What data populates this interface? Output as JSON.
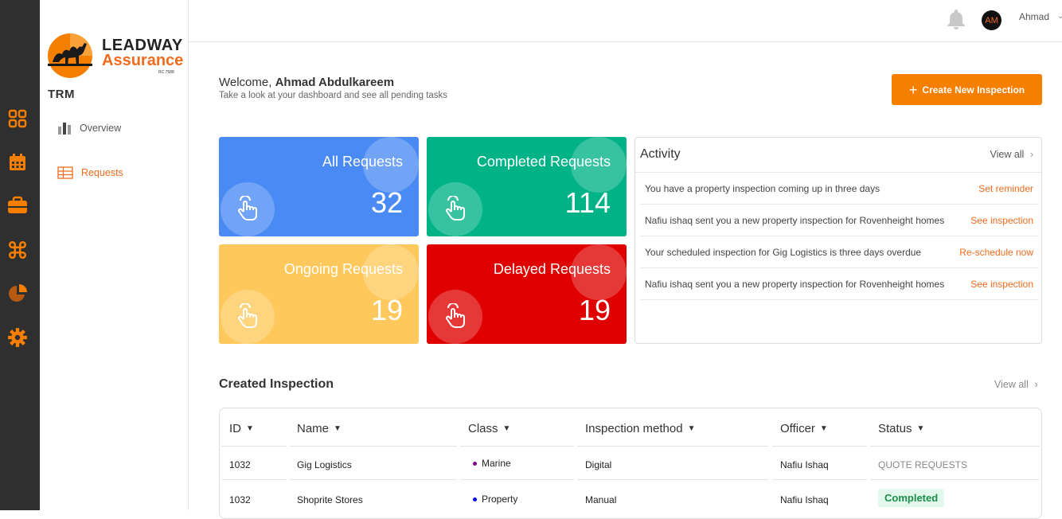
{
  "brand": {
    "line1": "LEADWAY",
    "line2": "Assurance",
    "rc": "RC 7588",
    "app": "TRM"
  },
  "nav": {
    "overview": "Overview",
    "requests": "Requests"
  },
  "user": {
    "initials": "AM",
    "name": "Ahmad"
  },
  "welcome": {
    "greeting": "Welcome,",
    "name": "Ahmad Abdulkareem",
    "subtitle": "Take a look at your dashboard and see all pending tasks"
  },
  "create_button": "Create New Inspection",
  "cards": [
    {
      "title": "All Requests",
      "count": "32",
      "color": "#4a8af4"
    },
    {
      "title": "Completed Requests",
      "count": "114",
      "color": "#00b386"
    },
    {
      "title": "Ongoing Requests",
      "count": "19",
      "color": "#ffc85c"
    },
    {
      "title": "Delayed Requests",
      "count": "19",
      "color": "#e00000"
    }
  ],
  "activity": {
    "title": "Activity",
    "view_all": "View all",
    "rows": [
      {
        "text": "You have a property inspection coming up in three days",
        "action": "Set reminder"
      },
      {
        "text": "Nafiu ishaq sent you a new property inspection for Rovenheight homes",
        "action": "See inspection"
      },
      {
        "text": "Your scheduled inspection for Gig Logistics is three days overdue",
        "action": "Re-schedule now"
      },
      {
        "text": "Nafiu ishaq sent you a new property inspection for Rovenheight homes",
        "action": "See inspection"
      }
    ]
  },
  "inspections": {
    "title": "Created Inspection",
    "view_all": "View all",
    "columns": [
      "ID",
      "Name",
      "Class",
      "Inspection method",
      "Officer",
      "Status"
    ],
    "rows": [
      {
        "id": "1032",
        "name": "Gig Logistics",
        "class": "Marine",
        "class_color": "#800080",
        "method": "Digital",
        "officer": "Nafiu Ishaq",
        "status": "QUOTE REQUESTS"
      },
      {
        "id": "1032",
        "name": "Shoprite Stores",
        "class": "Property",
        "class_color": "#0000ff",
        "method": "Manual",
        "officer": "Nafiu Ishaq",
        "status": "Completed"
      }
    ]
  },
  "colors": {
    "accent": "#f77f00",
    "rail": "#2f2f2f",
    "rail_icon": "#f77f00"
  }
}
